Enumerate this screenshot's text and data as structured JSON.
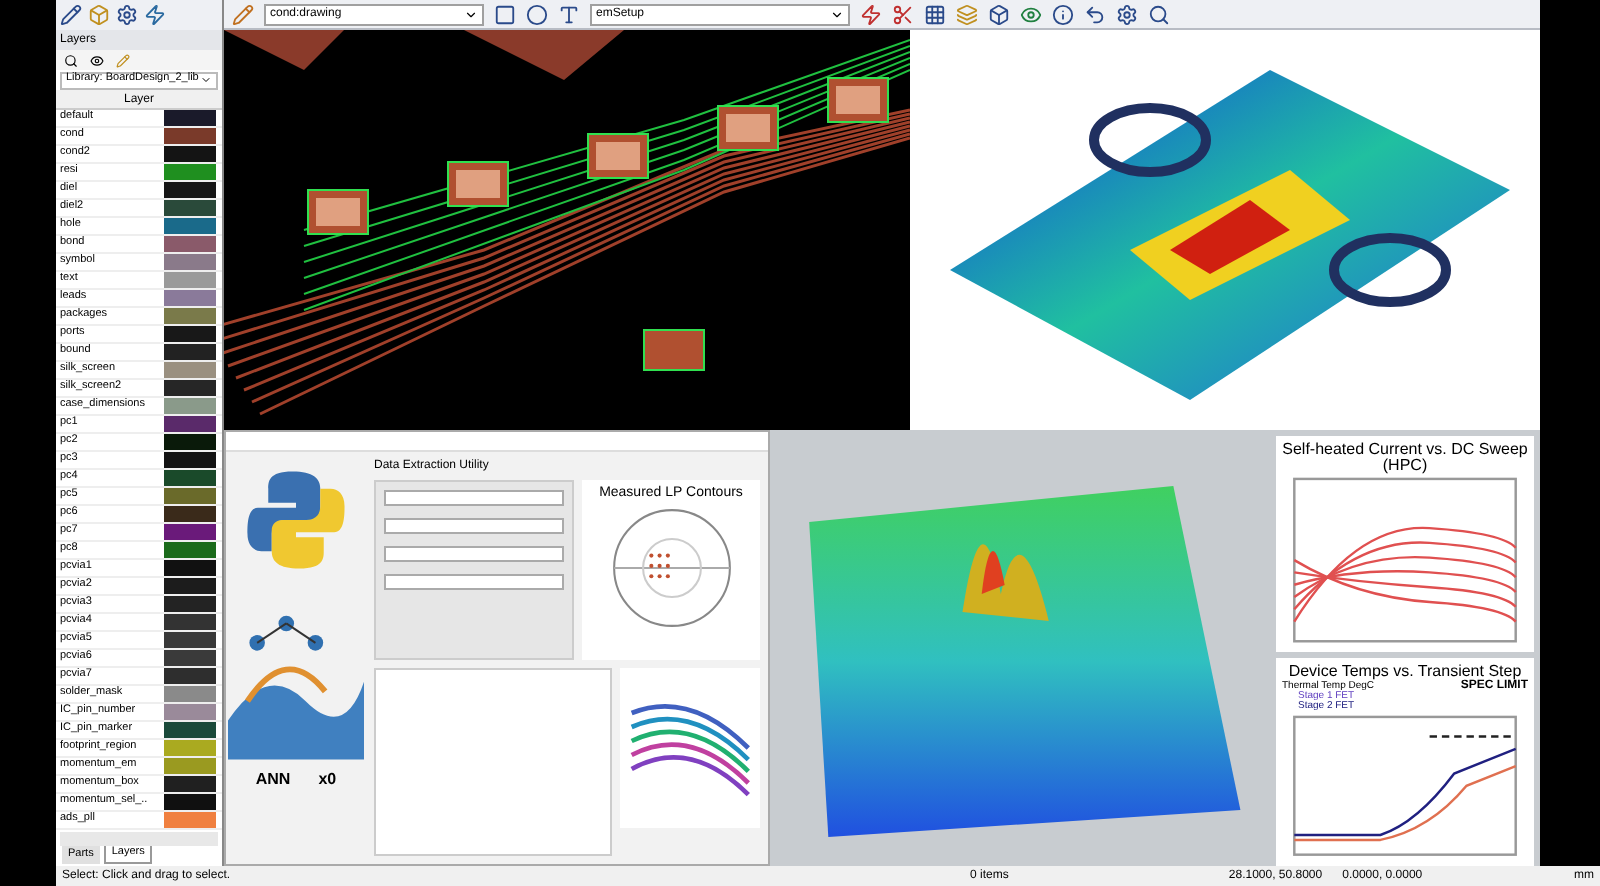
{
  "toolbar": {
    "layer_select": "cond:drawing",
    "setup_select": "emSetup"
  },
  "layers_panel": {
    "title": "Layers",
    "library": "Library: BoardDesign_2_lib",
    "column_header": "Layer",
    "layers": [
      {
        "name": "default",
        "color": "#1a1a2a"
      },
      {
        "name": "cond",
        "color": "#7a3a2a"
      },
      {
        "name": "cond2",
        "color": "#141414"
      },
      {
        "name": "resi",
        "color": "#1f8f1f"
      },
      {
        "name": "diel",
        "color": "#151515"
      },
      {
        "name": "diel2",
        "color": "#2a4a3a"
      },
      {
        "name": "hole",
        "color": "#1a6a8a"
      },
      {
        "name": "bond",
        "color": "#8a5a6a"
      },
      {
        "name": "symbol",
        "color": "#8a7a8a"
      },
      {
        "name": "text",
        "color": "#9a9a9a"
      },
      {
        "name": "leads",
        "color": "#8a7a9a"
      },
      {
        "name": "packages",
        "color": "#7a7a4a"
      },
      {
        "name": "ports",
        "color": "#181818"
      },
      {
        "name": "bound",
        "color": "#222222"
      },
      {
        "name": "silk_screen",
        "color": "#9a9080"
      },
      {
        "name": "silk_screen2",
        "color": "#262626"
      },
      {
        "name": "case_dimensions",
        "color": "#8a9a8a"
      },
      {
        "name": "pc1",
        "color": "#5a2a6a"
      },
      {
        "name": "pc2",
        "color": "#0a1a0a"
      },
      {
        "name": "pc3",
        "color": "#121212"
      },
      {
        "name": "pc4",
        "color": "#1a4a2a"
      },
      {
        "name": "pc5",
        "color": "#6a6a2a"
      },
      {
        "name": "pc6",
        "color": "#3a2a1a"
      },
      {
        "name": "pc7",
        "color": "#6a1a7a"
      },
      {
        "name": "pc8",
        "color": "#1a6a1a"
      },
      {
        "name": "pcvia1",
        "color": "#111111"
      },
      {
        "name": "pcvia2",
        "color": "#1c1c1c"
      },
      {
        "name": "pcvia3",
        "color": "#232323"
      },
      {
        "name": "pcvia4",
        "color": "#333333"
      },
      {
        "name": "pcvia5",
        "color": "#383838"
      },
      {
        "name": "pcvia6",
        "color": "#3a3a3a"
      },
      {
        "name": "pcvia7",
        "color": "#2e2e2e"
      },
      {
        "name": "solder_mask",
        "color": "#8a8a8a"
      },
      {
        "name": "IC_pin_number",
        "color": "#9a8a9a"
      },
      {
        "name": "IC_pin_marker",
        "color": "#1a4a3a"
      },
      {
        "name": "footprint_region",
        "color": "#aaaa20"
      },
      {
        "name": "momentum_em",
        "color": "#9a9a20"
      },
      {
        "name": "momentum_box",
        "color": "#202020"
      },
      {
        "name": "momentum_sel_..",
        "color": "#101010"
      },
      {
        "name": "ads_pll",
        "color": "#f08040"
      }
    ],
    "tabs": [
      {
        "label": "Parts",
        "selected": false
      },
      {
        "label": "Layers",
        "selected": true
      }
    ]
  },
  "python_window": {
    "title": "Data Extraction Utility",
    "plot_title": "Measured LP Contours",
    "network_label": "ANN",
    "axis_label": "x0"
  },
  "charts": [
    {
      "title": "Self-heated Current vs. DC Sweep (HPC)"
    },
    {
      "title": "Device Temps vs. Transient Step",
      "legend_title": "Thermal Temp DegC",
      "legend": [
        "Stage 1 FET",
        "Stage 2 FET"
      ],
      "annotation": "SPEC LIMIT"
    }
  ],
  "status_bar": {
    "message": "Select: Click and drag to select.",
    "items": "0 items",
    "coords": "28.1000, 50.8000",
    "offset": "0.0000, 0.0000",
    "unit": "mm"
  }
}
